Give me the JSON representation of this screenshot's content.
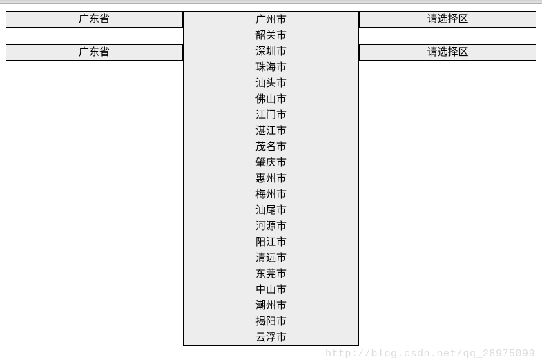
{
  "row1": {
    "province": "广东省",
    "city": "广州市",
    "district": "请选择区"
  },
  "row2": {
    "province": "广东省",
    "city": "",
    "district": "请选择区"
  },
  "city_options": [
    "广州市",
    "韶关市",
    "深圳市",
    "珠海市",
    "汕头市",
    "佛山市",
    "江门市",
    "湛江市",
    "茂名市",
    "肇庆市",
    "惠州市",
    "梅州市",
    "汕尾市",
    "河源市",
    "阳江市",
    "清远市",
    "东莞市",
    "中山市",
    "潮州市",
    "揭阳市",
    "云浮市"
  ],
  "watermark": "http://blog.csdn.net/qq_28975099"
}
